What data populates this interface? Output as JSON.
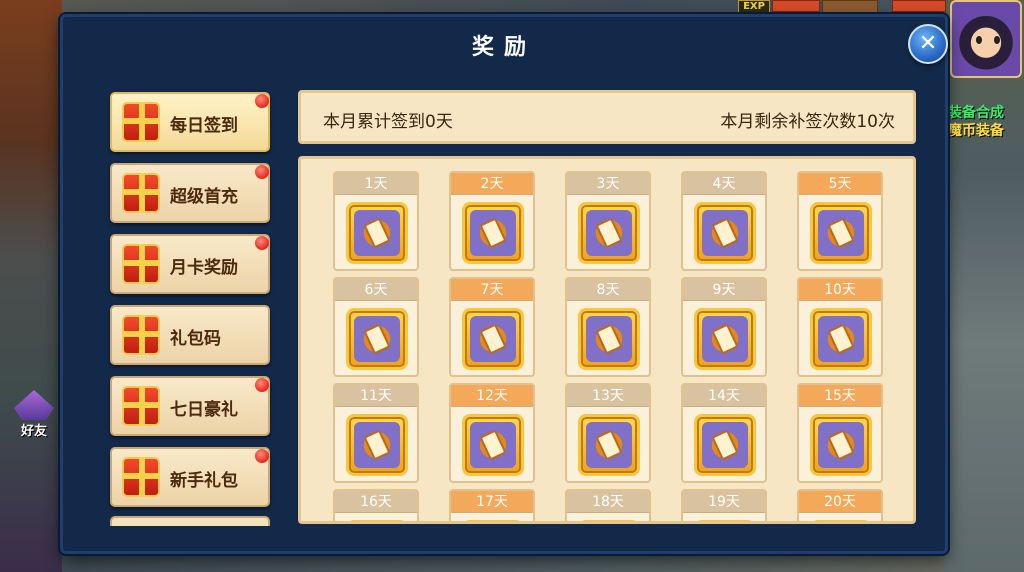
{
  "hud": {
    "exp_label": "EXP",
    "side_text_1": "装备合成",
    "side_text_2": "魔币装备",
    "friend_label": "好友"
  },
  "dialog": {
    "title": "奖励",
    "close_glyph": "✕"
  },
  "menu": {
    "items": [
      {
        "label": "每日签到",
        "has_dot": true,
        "active": true
      },
      {
        "label": "超级首充",
        "has_dot": true,
        "active": false
      },
      {
        "label": "月卡奖励",
        "has_dot": true,
        "active": false
      },
      {
        "label": "礼包码",
        "has_dot": false,
        "active": false
      },
      {
        "label": "七日豪礼",
        "has_dot": true,
        "active": false
      },
      {
        "label": "新手礼包",
        "has_dot": true,
        "active": false
      }
    ]
  },
  "checkin": {
    "monthly_total": "本月累计签到0天",
    "remaining_makeup": "本月剩余补签次数10次",
    "days": [
      {
        "label": "1天",
        "style": "gray"
      },
      {
        "label": "2天",
        "style": "orange"
      },
      {
        "label": "3天",
        "style": "gray"
      },
      {
        "label": "4天",
        "style": "gray"
      },
      {
        "label": "5天",
        "style": "orange"
      },
      {
        "label": "6天",
        "style": "gray"
      },
      {
        "label": "7天",
        "style": "orange"
      },
      {
        "label": "8天",
        "style": "gray"
      },
      {
        "label": "9天",
        "style": "gray"
      },
      {
        "label": "10天",
        "style": "orange"
      },
      {
        "label": "11天",
        "style": "gray"
      },
      {
        "label": "12天",
        "style": "orange"
      },
      {
        "label": "13天",
        "style": "gray"
      },
      {
        "label": "14天",
        "style": "gray"
      },
      {
        "label": "15天",
        "style": "orange"
      },
      {
        "label": "16天",
        "style": "gray"
      },
      {
        "label": "17天",
        "style": "orange"
      },
      {
        "label": "18天",
        "style": "gray"
      },
      {
        "label": "19天",
        "style": "gray"
      },
      {
        "label": "20天",
        "style": "orange"
      }
    ]
  }
}
